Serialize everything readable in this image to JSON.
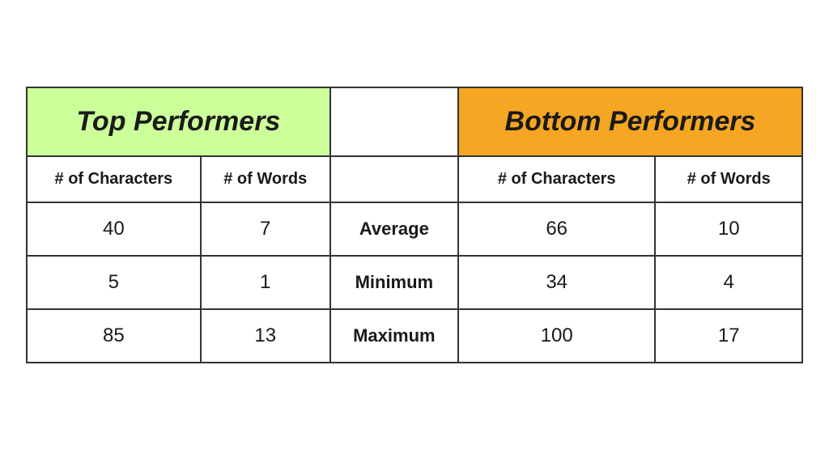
{
  "table": {
    "top_performers_label": "Top Performers",
    "bottom_performers_label": "Bottom Performers",
    "col_characters": "# of Characters",
    "col_words": "# of Words",
    "metrics": [
      {
        "label": "Average",
        "top_chars": "40",
        "top_words": "7",
        "bottom_chars": "66",
        "bottom_words": "10"
      },
      {
        "label": "Minimum",
        "top_chars": "5",
        "top_words": "1",
        "bottom_chars": "34",
        "bottom_words": "4"
      },
      {
        "label": "Maximum",
        "top_chars": "85",
        "top_words": "13",
        "bottom_chars": "100",
        "bottom_words": "17"
      }
    ]
  }
}
